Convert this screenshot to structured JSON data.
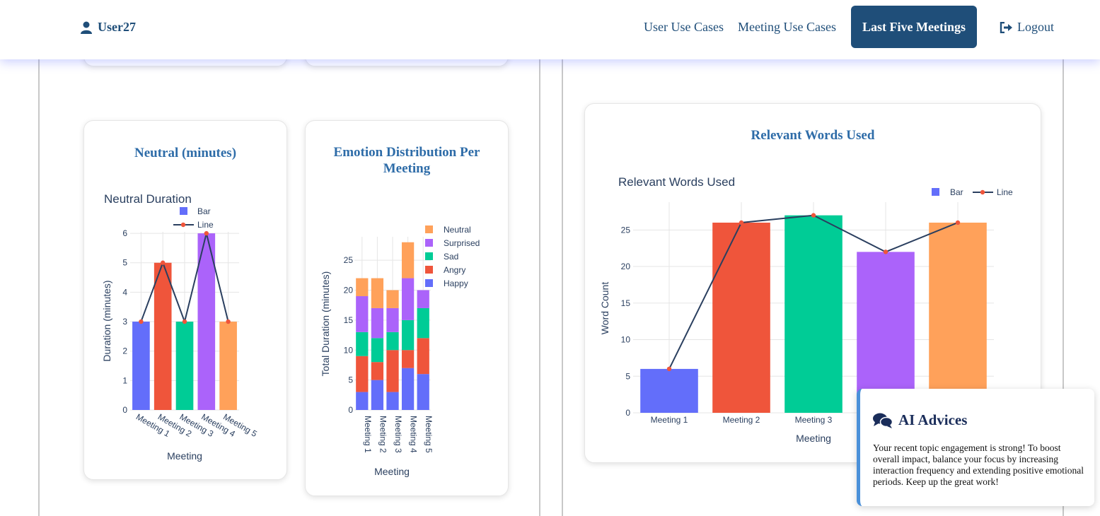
{
  "nav": {
    "user": "User27",
    "links": [
      "User Use Cases",
      "Meeting Use Cases"
    ],
    "active": "Last Five Meetings",
    "logout": "Logout"
  },
  "cards": {
    "neutral": {
      "title": "Neutral (minutes)"
    },
    "emotion": {
      "title": "Emotion Distribution Per Meeting"
    },
    "words": {
      "title": "Relevant Words Used"
    }
  },
  "ai": {
    "title": "AI Advices",
    "text": "Your recent topic engagement is strong! To boost overall impact, balance your focus by increasing interaction frequency and extending positive emotional periods. Keep up the great work!"
  },
  "colors": {
    "nav": "#1f4e79",
    "title": "#2e6ca8",
    "bar_palette": [
      "#636efa",
      "#ef553b",
      "#00cc96",
      "#ab63fa",
      "#ffa15a"
    ],
    "line": "#2a3f5f",
    "marker": "#ef553b"
  },
  "chart_data": [
    {
      "type": "bar",
      "title": "Neutral Duration",
      "xlabel": "Meeting",
      "ylabel": "Duration (minutes)",
      "categories": [
        "Meeting 1",
        "Meeting 2",
        "Meeting 3",
        "Meeting 4",
        "Meeting 5"
      ],
      "ylim": [
        0,
        6
      ],
      "ticks": [
        0,
        1,
        2,
        3,
        4,
        5,
        6
      ],
      "series": [
        {
          "name": "Bar",
          "type": "bar",
          "values": [
            3,
            5,
            3,
            6,
            3
          ]
        },
        {
          "name": "Line",
          "type": "line",
          "values": [
            3,
            5,
            3,
            6,
            3
          ]
        }
      ],
      "legend": "top"
    },
    {
      "type": "bar",
      "stacked": true,
      "title": "",
      "xlabel": "Meeting",
      "ylabel": "Total Duration (minutes)",
      "categories": [
        "Meeting 1",
        "Meeting 2",
        "Meeting 3",
        "Meeting 4",
        "Meeting 5"
      ],
      "ylim": [
        0,
        28
      ],
      "ticks": [
        0,
        5,
        10,
        15,
        20,
        25
      ],
      "series": [
        {
          "name": "Happy",
          "color": "#636efa",
          "values": [
            3,
            5,
            3,
            7,
            6
          ]
        },
        {
          "name": "Angry",
          "color": "#ef553b",
          "values": [
            6,
            3,
            7,
            3,
            6
          ]
        },
        {
          "name": "Sad",
          "color": "#00cc96",
          "values": [
            4,
            4,
            3,
            5,
            5
          ]
        },
        {
          "name": "Surprised",
          "color": "#ab63fa",
          "values": [
            6,
            5,
            4,
            7,
            3
          ]
        },
        {
          "name": "Neutral",
          "color": "#ffa15a",
          "values": [
            3,
            5,
            3,
            6,
            0
          ]
        }
      ],
      "legend": "right"
    },
    {
      "type": "bar",
      "title": "Relevant Words Used",
      "xlabel": "Meeting",
      "ylabel": "Word Count",
      "categories": [
        "Meeting 1",
        "Meeting 2",
        "Meeting 3",
        "Meeting 4",
        "Meeting 5"
      ],
      "ylim": [
        0,
        27
      ],
      "ticks": [
        0,
        5,
        10,
        15,
        20,
        25
      ],
      "series": [
        {
          "name": "Bar",
          "type": "bar",
          "values": [
            6,
            26,
            27,
            22,
            26
          ]
        },
        {
          "name": "Line",
          "type": "line",
          "values": [
            6,
            26,
            27,
            22,
            26
          ]
        }
      ],
      "legend": "top-right"
    }
  ]
}
